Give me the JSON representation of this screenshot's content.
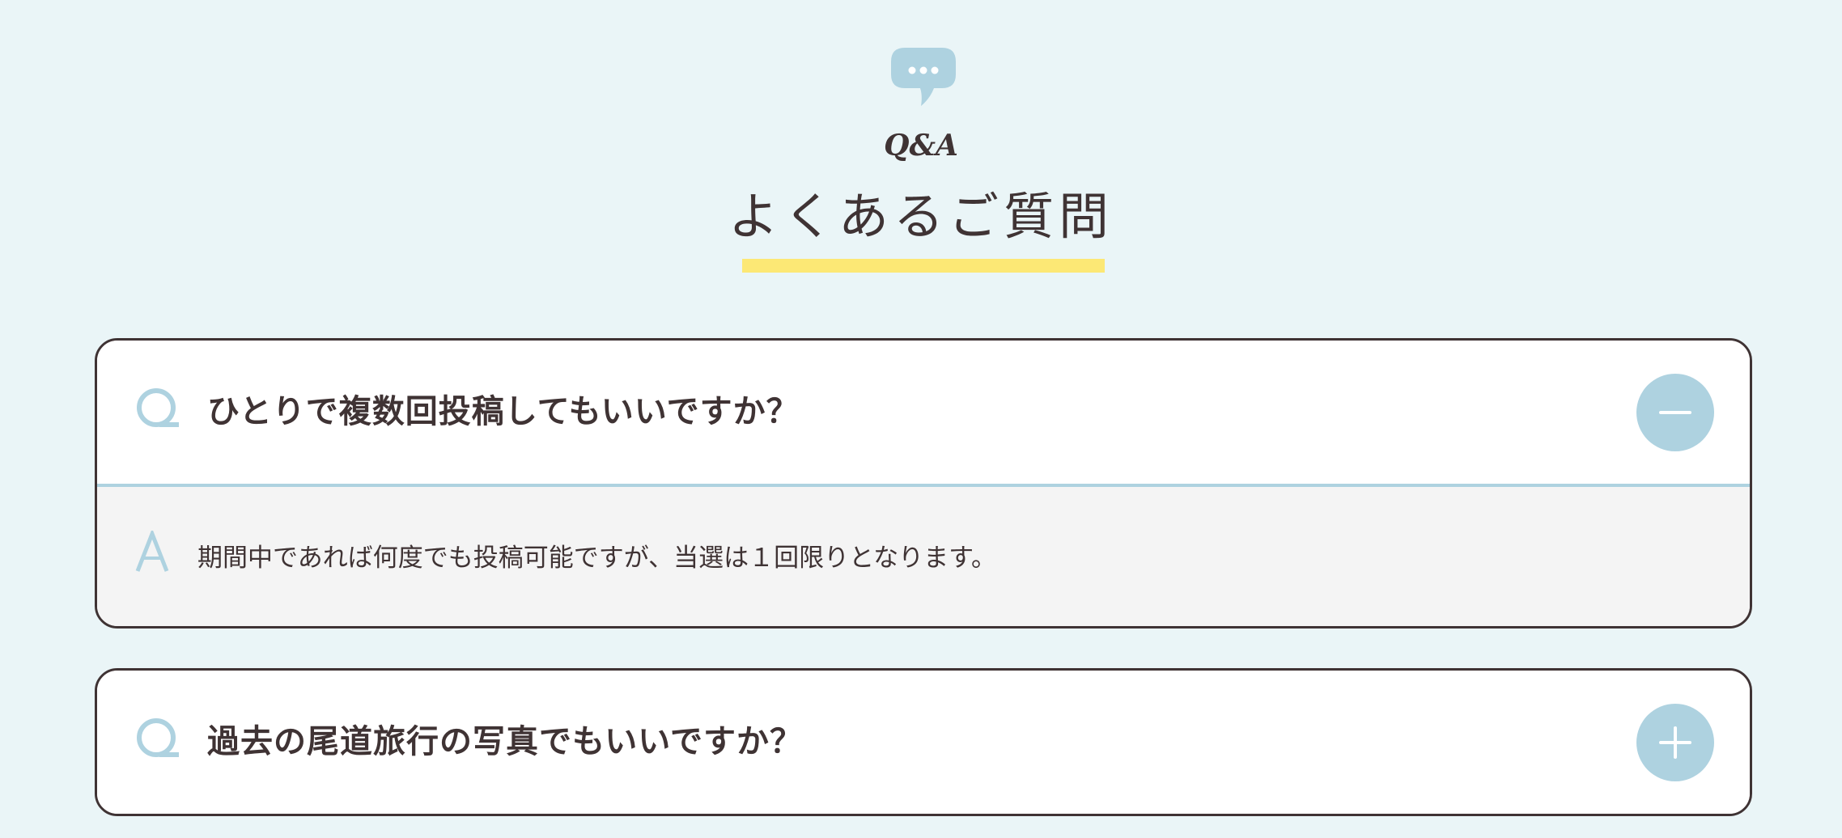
{
  "header": {
    "icon": "speech-bubble-icon",
    "subtitle": "Q&A",
    "title": "よくあるご質問"
  },
  "faq": [
    {
      "question_marker": "Q",
      "question": "ひとりで複数回投稿してもいいですか？",
      "expanded": true,
      "toggle_icon": "minus-icon",
      "answer_marker": "A",
      "answer": "期間中であれば何度でも投稿可能ですが、当選は１回限りとなります。"
    },
    {
      "question_marker": "Q",
      "question": "過去の尾道旅行の写真でもいいですか？",
      "expanded": false,
      "toggle_icon": "plus-icon"
    }
  ],
  "colors": {
    "background": "#eaf5f7",
    "accent": "#aed2e0",
    "highlight": "#fce875",
    "text": "#3f3334",
    "answer_background": "#f4f4f4"
  }
}
